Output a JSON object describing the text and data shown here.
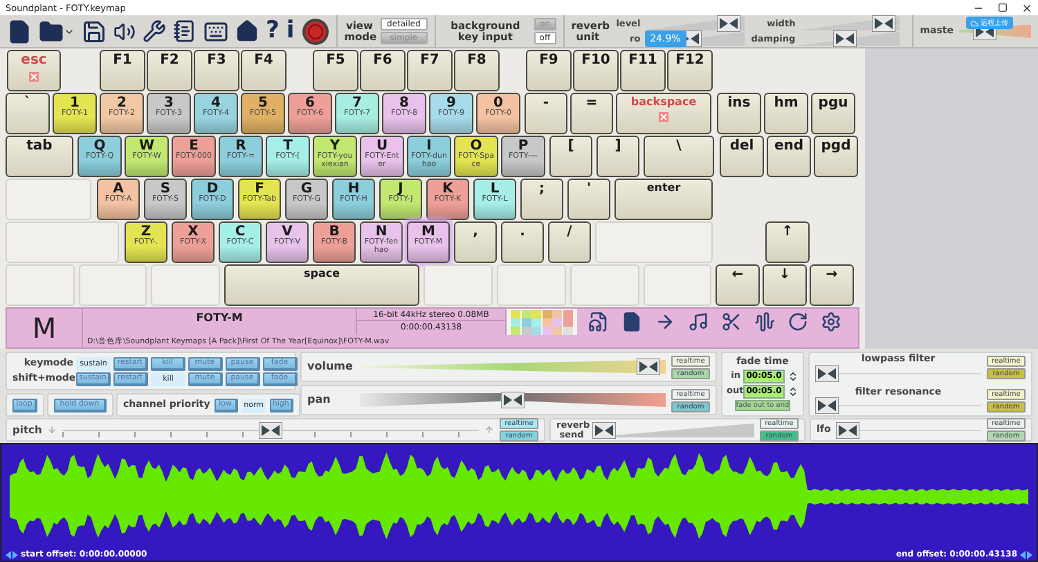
{
  "window": {
    "title": "Soundplant - FOTY.keymap"
  },
  "toolbar": {
    "glyph_buttons": [
      "?",
      "i"
    ],
    "view_mode": {
      "label": "view mode",
      "options": [
        {
          "label": "detailed",
          "selected": true
        },
        {
          "label": "simple",
          "selected": false
        }
      ]
    },
    "background_key_input": {
      "label": "background key input",
      "options": [
        {
          "label": "on",
          "selected": false
        },
        {
          "label": "off",
          "selected": true
        }
      ]
    },
    "reverb_unit": {
      "label": "reverb unit",
      "badge": "24.9%",
      "sliders": [
        {
          "label": "level",
          "level": 0.95
        },
        {
          "label": "width",
          "level": 0.95
        },
        {
          "label": "ro",
          "level": 0.45
        },
        {
          "label": "damping",
          "level": 0.45
        }
      ]
    },
    "master": {
      "label": "maste",
      "badge": "远程上传",
      "level": 0.3
    }
  },
  "keyboard": {
    "rows": [
      {
        "keys": [
          {
            "kind": "alert",
            "label": "esc",
            "selected": false
          },
          {
            "kind": "plain",
            "label": "F1",
            "selected": false
          },
          {
            "kind": "plain",
            "label": "F2",
            "selected": false
          },
          {
            "kind": "plain",
            "label": "F3",
            "selected": false
          },
          {
            "kind": "plain",
            "label": "F4",
            "selected": false
          },
          {
            "kind": "plain",
            "label": "F5",
            "selected": false
          },
          {
            "kind": "plain",
            "label": "F6",
            "selected": false
          },
          {
            "kind": "plain",
            "label": "F7",
            "selected": false
          },
          {
            "kind": "plain",
            "label": "F8",
            "selected": false
          },
          {
            "kind": "plain",
            "label": "F9",
            "selected": false
          },
          {
            "kind": "plain",
            "label": "F10",
            "selected": false
          },
          {
            "kind": "plain",
            "label": "F11",
            "selected": false
          },
          {
            "kind": "plain",
            "label": "F12",
            "selected": false
          }
        ]
      },
      {
        "keys": [
          {
            "kind": "plain",
            "label": "`",
            "selected": false
          },
          {
            "kind": "sample",
            "label": "1",
            "sample": "FOTY-1",
            "color": "#e4e452",
            "selected": false
          },
          {
            "kind": "sample",
            "label": "2",
            "sample": "FOTY-2",
            "color": "#f2c8a4",
            "selected": false
          },
          {
            "kind": "sample",
            "label": "3",
            "sample": "FOTY-3",
            "color": "#c8c8c8",
            "selected": false
          },
          {
            "kind": "sample",
            "label": "4",
            "sample": "FOTY-4",
            "color": "#98d4e0",
            "selected": false
          },
          {
            "kind": "sample",
            "label": "5",
            "sample": "FOTY-5",
            "color": "#e0b064",
            "selected": false
          },
          {
            "kind": "sample",
            "label": "6",
            "sample": "FOTY-6",
            "color": "#eea098",
            "selected": false
          },
          {
            "kind": "sample",
            "label": "7",
            "sample": "FOTY-7",
            "color": "#a6eee2",
            "selected": false
          },
          {
            "kind": "sample",
            "label": "8",
            "sample": "FOTY-8",
            "color": "#e8c2ea",
            "selected": false
          },
          {
            "kind": "sample",
            "label": "9",
            "sample": "FOTY-9",
            "color": "#a6dcea",
            "selected": false
          },
          {
            "kind": "sample",
            "label": "0",
            "sample": "FOTY-0",
            "color": "#f4c2a2",
            "selected": false
          },
          {
            "kind": "plain",
            "label": "-",
            "selected": false
          },
          {
            "kind": "plain",
            "label": "=",
            "selected": false
          },
          {
            "kind": "alert",
            "label": "backspace",
            "selected": false
          },
          {
            "kind": "plain",
            "label": "ins",
            "selected": false
          },
          {
            "kind": "plain",
            "label": "hm",
            "selected": false
          },
          {
            "kind": "plain",
            "label": "pgu",
            "selected": false
          }
        ]
      },
      {
        "keys": [
          {
            "kind": "plain",
            "label": "tab",
            "selected": false
          },
          {
            "kind": "sample",
            "label": "Q",
            "sample": "FOTY-Q",
            "color": "#8ccedc",
            "selected": false
          },
          {
            "kind": "sample",
            "label": "W",
            "sample": "FOTY-W",
            "color": "#c2e872",
            "selected": false
          },
          {
            "kind": "sample",
            "label": "E",
            "sample": "FOTY-000",
            "color": "#eea098",
            "selected": false
          },
          {
            "kind": "sample",
            "label": "R",
            "sample": "FOTY-=",
            "color": "#8ccedc",
            "selected": false
          },
          {
            "kind": "sample",
            "label": "T",
            "sample": "FOTY-[",
            "color": "#a6eee8",
            "selected": false
          },
          {
            "kind": "sample",
            "label": "Y",
            "sample": "FOTY-youxiexian",
            "color": "#c2e872",
            "selected": false
          },
          {
            "kind": "sample",
            "label": "U",
            "sample": "FOTY-Enter",
            "color": "#e8c2ea",
            "selected": false
          },
          {
            "kind": "sample",
            "label": "I",
            "sample": "FOTY-dunhao",
            "color": "#8ccedc",
            "selected": false
          },
          {
            "kind": "sample",
            "label": "O",
            "sample": "FOTY-Space",
            "color": "#e4e452",
            "selected": false
          },
          {
            "kind": "sample",
            "label": "P",
            "sample": "FOTY-—",
            "color": "#c8c8c8",
            "selected": false
          },
          {
            "kind": "plain",
            "label": "[",
            "selected": false
          },
          {
            "kind": "plain",
            "label": "]",
            "selected": false
          },
          {
            "kind": "plain",
            "label": "\\",
            "selected": false
          },
          {
            "kind": "plain",
            "label": "del",
            "selected": false
          },
          {
            "kind": "plain",
            "label": "end",
            "selected": false
          },
          {
            "kind": "plain",
            "label": "pgd",
            "selected": false
          }
        ]
      },
      {
        "keys": [
          {
            "kind": "sample",
            "label": "A",
            "sample": "FOTY-A",
            "color": "#f4c2a2",
            "selected": false
          },
          {
            "kind": "sample",
            "label": "S",
            "sample": "FOTY-S",
            "color": "#c8c8c8",
            "selected": false
          },
          {
            "kind": "sample",
            "label": "D",
            "sample": "FOTY-D",
            "color": "#8ccedc",
            "selected": false
          },
          {
            "kind": "sample",
            "label": "F",
            "sample": "FOTY-Tab",
            "color": "#e4e452",
            "selected": false
          },
          {
            "kind": "sample",
            "label": "G",
            "sample": "FOTY-G",
            "color": "#c8c8c8",
            "selected": false
          },
          {
            "kind": "sample",
            "label": "H",
            "sample": "FOTY-H",
            "color": "#8ccedc",
            "selected": false
          },
          {
            "kind": "sample",
            "label": "J",
            "sample": "FOTY-J",
            "color": "#c2e872",
            "selected": false
          },
          {
            "kind": "sample",
            "label": "K",
            "sample": "FOTY-K",
            "color": "#eea098",
            "selected": false
          },
          {
            "kind": "sample",
            "label": "L",
            "sample": "FOTY-L",
            "color": "#a6eee8",
            "selected": false
          },
          {
            "kind": "plain",
            "label": ";",
            "selected": false
          },
          {
            "kind": "plain",
            "label": "'",
            "selected": false
          },
          {
            "kind": "plain",
            "label": "enter",
            "selected": false
          }
        ]
      },
      {
        "keys": [
          {
            "kind": "sample",
            "label": "Z",
            "sample": "FOTY-.",
            "color": "#e4e452",
            "selected": false
          },
          {
            "kind": "sample",
            "label": "X",
            "sample": "FOTY-X",
            "color": "#eea098",
            "selected": false
          },
          {
            "kind": "sample",
            "label": "C",
            "sample": "FOTY-C",
            "color": "#a6eee8",
            "selected": false
          },
          {
            "kind": "sample",
            "label": "V",
            "sample": "FOTY-V",
            "color": "#e8c2ea",
            "selected": false
          },
          {
            "kind": "sample",
            "label": "B",
            "sample": "FOTY-B",
            "color": "#eea098",
            "selected": false
          },
          {
            "kind": "sample",
            "label": "N",
            "sample": "FOTY-fenhao",
            "color": "#e8c2ea",
            "selected": false
          },
          {
            "kind": "sample",
            "label": "M",
            "sample": "FOTY-M",
            "color": "#e8c2ea",
            "selected": true
          },
          {
            "kind": "plain",
            "label": ",",
            "selected": false
          },
          {
            "kind": "plain",
            "label": ".",
            "selected": false
          },
          {
            "kind": "plain",
            "label": "/",
            "selected": false
          },
          {
            "kind": "plain",
            "label": "↑",
            "selected": false
          }
        ]
      },
      {
        "keys": [
          {
            "kind": "plain",
            "label": "space",
            "selected": false
          },
          {
            "kind": "plain",
            "label": "←",
            "selected": false
          },
          {
            "kind": "plain",
            "label": "↓",
            "selected": false
          },
          {
            "kind": "plain",
            "label": "→",
            "selected": false
          }
        ]
      }
    ]
  },
  "sample_info": {
    "key": "M",
    "name": "FOTY-M",
    "format": "16-bit 44kHz stereo 0.08MB",
    "length": "0:00:00.43138",
    "path": "D:\\音色库\\Soundplant Keymaps [A Pack]\\First Of The Year[Equinox]\\FOTY-M.wav",
    "swatches": [
      {
        "color": "#e4e452"
      },
      {
        "color": "#c2e872"
      },
      {
        "color": "#e4e452"
      },
      {
        "color": "#e0b064"
      },
      {
        "color": "#f4c2a2"
      },
      {
        "color": "#eea098"
      },
      {
        "color": "#a6eee2"
      },
      {
        "color": "#8ccedc"
      },
      {
        "color": "#a6eee8"
      },
      {
        "color": "#f4c2a2"
      },
      {
        "color": "#e8c2ea"
      },
      {
        "color": "#eea098"
      },
      {
        "color": "#c2e872"
      },
      {
        "color": "#c8c8c8"
      },
      {
        "color": "#a6dcea"
      },
      {
        "color": "#e8c2ea"
      },
      {
        "color": "#f2c8a4"
      },
      {
        "color": "#e0e0e0"
      }
    ]
  },
  "modes": {
    "rows": [
      {
        "label": "keymode",
        "options": [
          {
            "label": "sustain",
            "selected": true
          },
          {
            "label": "restart",
            "selected": false
          },
          {
            "label": "kill",
            "selected": false
          },
          {
            "label": "mute",
            "selected": false
          },
          {
            "label": "pause",
            "selected": false
          },
          {
            "label": "fade",
            "selected": false
          }
        ]
      },
      {
        "label": "shift+mode",
        "options": [
          {
            "label": "sustain",
            "selected": false
          },
          {
            "label": "restart",
            "selected": false
          },
          {
            "label": "kill",
            "selected": true
          },
          {
            "label": "mute",
            "selected": false
          },
          {
            "label": "pause",
            "selected": false
          },
          {
            "label": "fade",
            "selected": false
          }
        ]
      }
    ],
    "loop": "loop",
    "hold_down": "hold down",
    "channel_priority": {
      "label": "channel priority",
      "options": [
        {
          "label": "low",
          "selected": false
        },
        {
          "label": "norm",
          "selected": true
        },
        {
          "label": "high",
          "selected": false
        }
      ]
    }
  },
  "volume": {
    "label": "volume",
    "level": 0.98,
    "realtime": "realtime",
    "random": "random"
  },
  "pan": {
    "label": "pan",
    "level": 0.5,
    "realtime": "realtime",
    "random": "random"
  },
  "fade_time": {
    "label": "fade time",
    "in_label": "in",
    "in_value": "00:05.0",
    "out_label": "out",
    "out_value": "00:05.0",
    "button": "fade out to end"
  },
  "filters": [
    {
      "label": "lowpass filter",
      "level": 0,
      "realtime": "realtime",
      "random": "random"
    },
    {
      "label": "filter resonance",
      "level": 0,
      "realtime": "realtime",
      "random": "random"
    }
  ],
  "pitch": {
    "label": "pitch",
    "level": 0.5,
    "realtime": "realtime",
    "random": "random"
  },
  "reverb_send": {
    "label": "reverb send",
    "level": 0,
    "realtime": "realtime",
    "random": "random"
  },
  "lfo": {
    "label": "lfo",
    "level": 0,
    "realtime": "realtime",
    "random": "random"
  },
  "waveform": {
    "start_offset": "start offset: 0:00:00.00000",
    "end_offset": "end offset: 0:00:00.43138"
  }
}
